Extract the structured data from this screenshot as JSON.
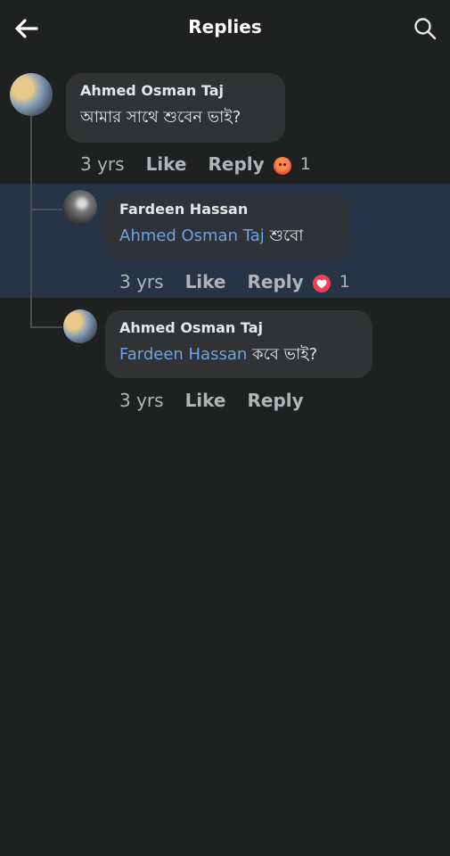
{
  "header": {
    "title": "Replies",
    "back_icon": "arrow-left-icon",
    "search_icon": "search-icon"
  },
  "colors": {
    "background": "#1f2020",
    "bubble": "#303233",
    "highlight": "#263445",
    "mention": "#6ea1e6",
    "muted": "#b0b3b8"
  },
  "comments": [
    {
      "author": "Ahmed Osman Taj",
      "mention": "",
      "text": "আমার সাথে শুবেন ভাই?",
      "time": "3 yrs",
      "like_label": "Like",
      "reply_label": "Reply",
      "reaction_icon": "angry-reaction-icon",
      "reaction_count": "1"
    },
    {
      "author": "Fardeen Hassan",
      "mention": "Ahmed Osman Taj",
      "text": " শুবো",
      "time": "3 yrs",
      "like_label": "Like",
      "reply_label": "Reply",
      "reaction_icon": "love-reaction-icon",
      "reaction_count": "1"
    },
    {
      "author": "Ahmed Osman Taj",
      "mention": "Fardeen Hassan",
      "text": " কবে ভাই?",
      "time": "3 yrs",
      "like_label": "Like",
      "reply_label": "Reply",
      "reaction_icon": "",
      "reaction_count": ""
    }
  ]
}
